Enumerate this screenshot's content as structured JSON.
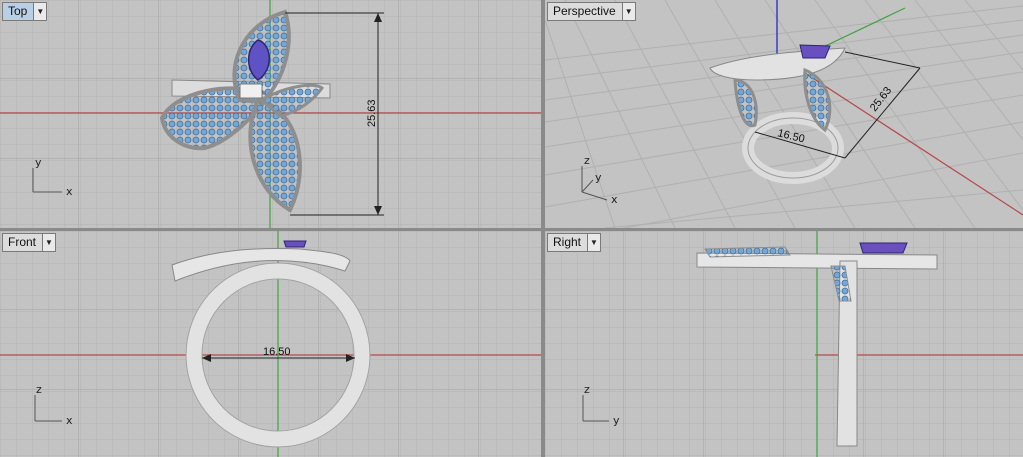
{
  "viewports": {
    "top": {
      "label": "Top",
      "axis_h": "x",
      "axis_v": "y",
      "dimension": "25.63"
    },
    "perspective": {
      "label": "Perspective",
      "axis_x": "x",
      "axis_y": "y",
      "axis_z": "z",
      "dimension_a": "25.63",
      "dimension_b": "16.50"
    },
    "front": {
      "label": "Front",
      "axis_h": "x",
      "axis_v": "z",
      "dimension": "16.50"
    },
    "right": {
      "label": "Right",
      "axis_h": "y",
      "axis_v": "z"
    }
  },
  "colors": {
    "viewport_bg": "#c3c3c3",
    "grid_minor": "#b4b4b4",
    "grid_major": "#a5a5a5",
    "x_axis": "#b84747",
    "y_axis": "#3fa33f",
    "z_axis": "#3a3ad0",
    "metal": "#e4e4e4",
    "metal_shade": "#9c9c9c",
    "stone": "#74a7d6",
    "center_stone": "#5f52c4",
    "active_tab": "#b9cfe6"
  },
  "icons": {
    "dropdown": "triangle-down-icon"
  }
}
